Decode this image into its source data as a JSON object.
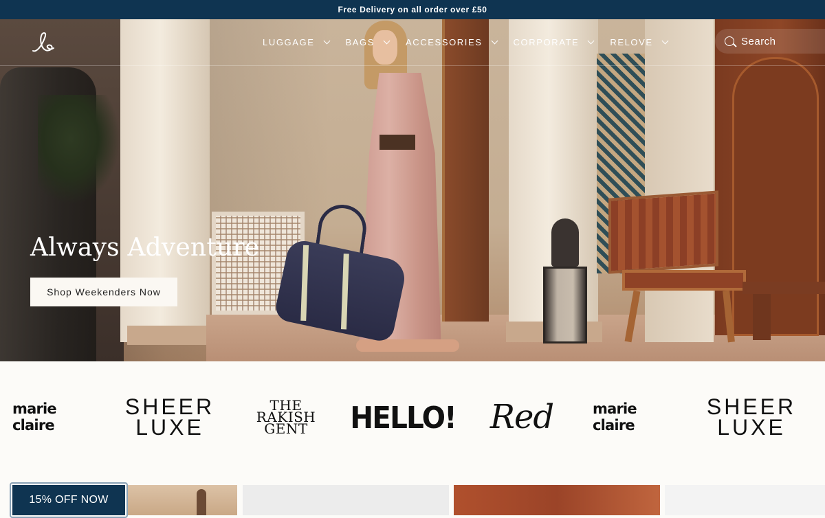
{
  "announcement": "Free Delivery on all order over £50",
  "brand": {
    "logo_icon": "script-initials-logo-icon"
  },
  "nav": {
    "items": [
      {
        "label": "LUGGAGE"
      },
      {
        "label": "BAGS"
      },
      {
        "label": "ACCESSORIES"
      },
      {
        "label": "CORPORATE"
      },
      {
        "label": "RELOVE"
      }
    ],
    "search_label": "Search"
  },
  "hero": {
    "title": "Always Adventure",
    "cta": "Shop Weekenders Now"
  },
  "press": [
    {
      "name": "marie claire"
    },
    {
      "name_line1": "SHEER",
      "name_line2": "LUXE"
    },
    {
      "name_line1": "THE",
      "name_line2": "RAKISH",
      "name_line3": "GENT"
    },
    {
      "name": "HELLO!"
    },
    {
      "name": "Red"
    },
    {
      "name": "marie claire"
    },
    {
      "name_line1": "SHEER",
      "name_line2": "LUXE"
    }
  ],
  "discount_tab": "15% OFF NOW",
  "colors": {
    "navy": "#0f3451",
    "cream": "#fcfbf8"
  }
}
